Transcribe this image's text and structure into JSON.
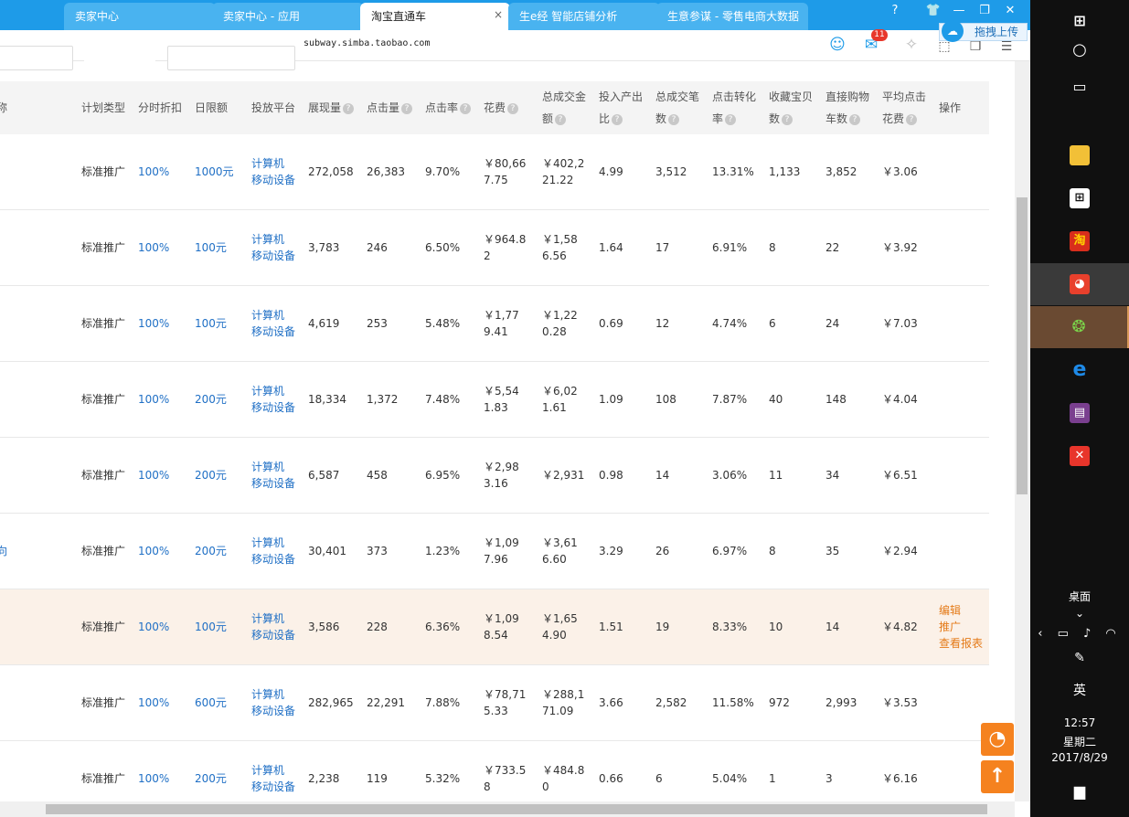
{
  "browser": {
    "tabs": [
      {
        "label": "卖家中心"
      },
      {
        "label": "卖家中心 - 应用"
      },
      {
        "label": "淘宝直通车",
        "active": true
      },
      {
        "label": "生e经 智能店铺分析"
      },
      {
        "label": "生意参谋 - 零售电商大数据"
      }
    ],
    "tab_close": "×",
    "url": "subway.simba.taobao.com",
    "mail_badge": "11",
    "upload_label": "拖拽上传",
    "window_buttons": [
      "?",
      "👕",
      "—",
      "❐",
      "✕"
    ]
  },
  "table": {
    "columns": [
      {
        "label": "称"
      },
      {
        "label": "计划类型"
      },
      {
        "label": "分时折扣"
      },
      {
        "label": "日限额"
      },
      {
        "label": "投放平台"
      },
      {
        "label": "展现量",
        "help": true
      },
      {
        "label": "点击量",
        "help": true
      },
      {
        "label": "点击率",
        "help": true
      },
      {
        "label": "花费",
        "help": true
      },
      {
        "label": "总成交金",
        "label2": "额",
        "help": true
      },
      {
        "label": "投入产出",
        "label2": "比",
        "help": true
      },
      {
        "label": "总成交笔",
        "label2": "数",
        "help": true
      },
      {
        "label": "点击转化",
        "label2": "率",
        "help": true
      },
      {
        "label": "收藏宝贝",
        "label2": "数",
        "help": true
      },
      {
        "label": "直接购物",
        "label2": "车数",
        "help": true
      },
      {
        "label": "平均点击",
        "label2": "花费",
        "help": true
      },
      {
        "label": "操作"
      }
    ],
    "help_glyph": "?",
    "platform_line1": "计算机",
    "platform_line2": "移动设备",
    "rows": [
      {
        "name": "",
        "type": "标准推广",
        "discount": "100%",
        "budget": "1000元",
        "impressions": "272,058",
        "clicks": "26,383",
        "ctr": "9.70%",
        "cost1": "￥80,66",
        "cost2": "7.75",
        "gmv1": "￥402,2",
        "gmv2": "21.22",
        "roi": "4.99",
        "orders": "3,512",
        "cvr": "13.31%",
        "fav": "1,133",
        "cart": "3,852",
        "cpc": "￥3.06"
      },
      {
        "name": "",
        "type": "标准推广",
        "discount": "100%",
        "budget": "100元",
        "impressions": "3,783",
        "clicks": "246",
        "ctr": "6.50%",
        "cost1": "￥964.8",
        "cost2": "2",
        "gmv1": "￥1,58",
        "gmv2": "6.56",
        "roi": "1.64",
        "orders": "17",
        "cvr": "6.91%",
        "fav": "8",
        "cart": "22",
        "cpc": "￥3.92"
      },
      {
        "name": "",
        "type": "标准推广",
        "discount": "100%",
        "budget": "100元",
        "impressions": "4,619",
        "clicks": "253",
        "ctr": "5.48%",
        "cost1": "￥1,77",
        "cost2": "9.41",
        "gmv1": "￥1,22",
        "gmv2": "0.28",
        "roi": "0.69",
        "orders": "12",
        "cvr": "4.74%",
        "fav": "6",
        "cart": "24",
        "cpc": "￥7.03"
      },
      {
        "name": "",
        "type": "标准推广",
        "discount": "100%",
        "budget": "200元",
        "impressions": "18,334",
        "clicks": "1,372",
        "ctr": "7.48%",
        "cost1": "￥5,54",
        "cost2": "1.83",
        "gmv1": "￥6,02",
        "gmv2": "1.61",
        "roi": "1.09",
        "orders": "108",
        "cvr": "7.87%",
        "fav": "40",
        "cart": "148",
        "cpc": "￥4.04"
      },
      {
        "name": "",
        "type": "标准推广",
        "discount": "100%",
        "budget": "200元",
        "impressions": "6,587",
        "clicks": "458",
        "ctr": "6.95%",
        "cost1": "￥2,98",
        "cost2": "3.16",
        "gmv1": "￥2,931",
        "gmv2": "",
        "roi": "0.98",
        "orders": "14",
        "cvr": "3.06%",
        "fav": "11",
        "cart": "34",
        "cpc": "￥6.51"
      },
      {
        "name": "向",
        "type": "标准推广",
        "discount": "100%",
        "budget": "200元",
        "impressions": "30,401",
        "clicks": "373",
        "ctr": "1.23%",
        "cost1": "￥1,09",
        "cost2": "7.96",
        "gmv1": "￥3,61",
        "gmv2": "6.60",
        "roi": "3.29",
        "orders": "26",
        "cvr": "6.97%",
        "fav": "8",
        "cart": "35",
        "cpc": "￥2.94"
      },
      {
        "name": "",
        "type": "标准推广",
        "discount": "100%",
        "budget": "100元",
        "impressions": "3,586",
        "clicks": "228",
        "ctr": "6.36%",
        "cost1": "￥1,09",
        "cost2": "8.54",
        "gmv1": "￥1,65",
        "gmv2": "4.90",
        "roi": "1.51",
        "orders": "19",
        "cvr": "8.33%",
        "fav": "10",
        "cart": "14",
        "cpc": "￥4.82",
        "highlight": true,
        "actions": [
          "编辑",
          "推广",
          "查看报表"
        ]
      },
      {
        "name": "",
        "type": "标准推广",
        "discount": "100%",
        "budget": "600元",
        "impressions": "282,965",
        "clicks": "22,291",
        "ctr": "7.88%",
        "cost1": "￥78,71",
        "cost2": "5.33",
        "gmv1": "￥288,1",
        "gmv2": "71.09",
        "roi": "3.66",
        "orders": "2,582",
        "cvr": "11.58%",
        "fav": "972",
        "cart": "2,993",
        "cpc": "￥3.53"
      },
      {
        "name": "",
        "type": "标准推广",
        "discount": "100%",
        "budget": "200元",
        "impressions": "2,238",
        "clicks": "119",
        "ctr": "5.32%",
        "cost1": "￥733.5",
        "cost2": "8",
        "gmv1": "￥484.8",
        "gmv2": "0",
        "roi": "0.66",
        "orders": "6",
        "cvr": "5.04%",
        "fav": "1",
        "cart": "3",
        "cpc": "￥6.16"
      }
    ]
  },
  "taskbar": {
    "desktop_label": "桌面",
    "ime": "英",
    "time": "12:57",
    "weekday": "星期二",
    "date": "2017/8/29"
  }
}
